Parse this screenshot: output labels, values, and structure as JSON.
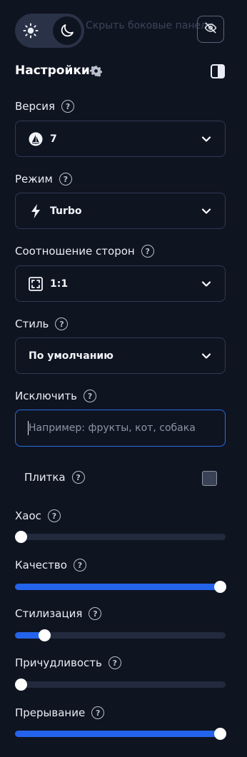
{
  "top_bar": {
    "hidden_text": "Скрыть боковые панели",
    "theme_icons": [
      "sun-icon",
      "moon-icon"
    ],
    "hide_icon": "eye-off-icon"
  },
  "settings": {
    "title": "Настройки",
    "gear_icon": "gear-icon",
    "layout_icon": "sidebar-layout-icon"
  },
  "version": {
    "label": "Версия",
    "value": "7",
    "icon": "sail-logo-icon"
  },
  "mode": {
    "label": "Режим",
    "value": "Turbo",
    "icon": "lightning-icon"
  },
  "aspect": {
    "label": "Соотношение сторон",
    "value": "1:1",
    "icon": "frame-corners-icon"
  },
  "style": {
    "label": "Стиль",
    "value": "По умолчанию"
  },
  "exclude": {
    "label": "Исключить",
    "placeholder": "Например: фрукты, кот, собака",
    "value": ""
  },
  "tile": {
    "label": "Плитка",
    "checked": false
  },
  "sliders": [
    {
      "label": "Хаос",
      "value": 0.0
    },
    {
      "label": "Качество",
      "value": 1.0
    },
    {
      "label": "Стилизация",
      "value": 0.12
    },
    {
      "label": "Причудливость",
      "value": 0.0
    },
    {
      "label": "Прерывание",
      "value": 1.0
    }
  ],
  "help_glyph": "?",
  "colors": {
    "background": "#0f1421",
    "accent": "#2463eb",
    "focus_border": "#2b6de8",
    "track": "#222b3d",
    "toggle_bg": "#2a3247"
  }
}
